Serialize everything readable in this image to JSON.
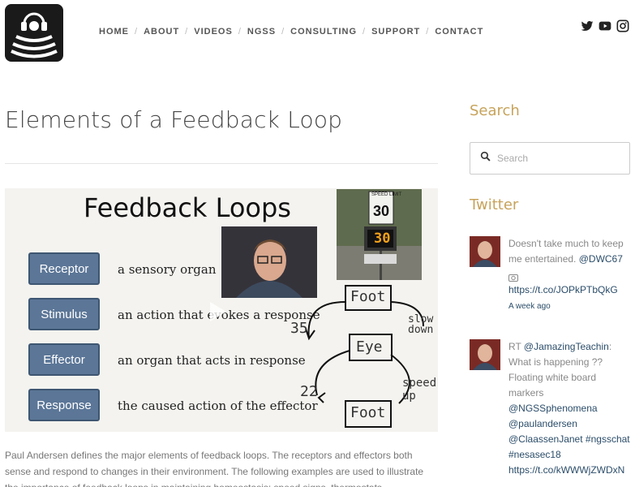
{
  "header": {
    "logo_icon": "headphones-signal-logo-icon",
    "nav": [
      "HOME",
      "ABOUT",
      "VIDEOS",
      "NGSS",
      "CONSULTING",
      "SUPPORT",
      "CONTACT"
    ],
    "social": [
      "twitter-icon",
      "youtube-icon",
      "instagram-icon"
    ]
  },
  "post": {
    "title": "Elements of a Feedback Loop",
    "video": {
      "title": "Feedback Loops",
      "rows": [
        {
          "term": "Receptor",
          "definition": "a sensory organ"
        },
        {
          "term": "Stimulus",
          "definition": "an action that evokes a response"
        },
        {
          "term": "Effector",
          "definition": "an organ that acts in response"
        },
        {
          "term": "Response",
          "definition": "the caused action of the effector"
        }
      ],
      "sign": {
        "top": "SPEED LIMIT",
        "limit": "30",
        "reading": "30"
      },
      "sketch": {
        "foot_top": "Foot",
        "eye": "Eye",
        "foot_bottom": "Foot",
        "left_num": "35",
        "right_label": "slow down",
        "bottom_num": "22",
        "speed_up": "speed up"
      }
    },
    "excerpt": "Paul Andersen defines the major elements of feedback loops. The receptors and effectors both sense and respond to changes in their environment. The following examples are used to illustrate the importance of feedback loops in maintaining homeostasis: speed signs, thermostats"
  },
  "sidebar": {
    "search_heading": "Search",
    "search_placeholder": "Search",
    "twitter_heading": "Twitter",
    "tweets": [
      {
        "text": "Doesn't take much to keep me entertained. ",
        "mention": "@DWC67",
        "link": "https://t.co/JOPkPTbQkG",
        "time": "A week ago"
      },
      {
        "prefix": "RT ",
        "mention": "@JamazingTeachin",
        "text": ": What is happening ?? Floating white board markers",
        "tags": [
          "@NGSSphenomena",
          "@paulandersen",
          "@ClaassenJanet",
          "#ngsschat",
          "#nesasec18"
        ],
        "link": "https://t.co/kWWWjZWDxN"
      }
    ]
  },
  "colors": {
    "accent": "#c7a35b",
    "link": "#2b4d6a",
    "term_box": "#5b7697"
  }
}
